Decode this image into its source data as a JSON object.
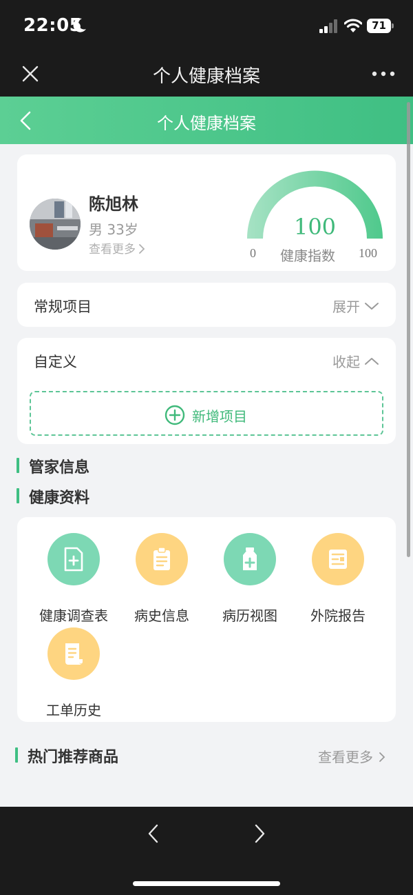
{
  "status_bar": {
    "time": "22:05",
    "battery": "71"
  },
  "app_bar": {
    "title": "个人健康档案"
  },
  "header": {
    "title": "个人健康档案"
  },
  "profile": {
    "name": "陈旭林",
    "info": "男 33岁",
    "more_link": "查看更多",
    "health_index": {
      "value": "100",
      "min": "0",
      "max": "100",
      "label": "健康指数",
      "level": 1.0
    }
  },
  "sections": {
    "regular": {
      "title": "常规项目",
      "toggle": "展开"
    },
    "custom": {
      "title": "自定义",
      "toggle": "收起",
      "add_button": "新增项目"
    }
  },
  "headings": {
    "steward": "管家信息",
    "health_materials": "健康资料",
    "products": "热门推荐商品"
  },
  "materials": [
    {
      "label": "健康调查表",
      "icon": "health-survey-icon",
      "color": "#7dd8b4"
    },
    {
      "label": "病史信息",
      "icon": "medical-history-icon",
      "color": "#fed581"
    },
    {
      "label": "病历视图",
      "icon": "medical-record-icon",
      "color": "#7dd8b4"
    },
    {
      "label": "外院报告",
      "icon": "external-report-icon",
      "color": "#fed581"
    },
    {
      "label": "工单历史",
      "icon": "work-order-history-icon",
      "color": "#fed581"
    }
  ],
  "products": {
    "more_link": "查看更多"
  },
  "colors": {
    "accent": "#3fbf83",
    "header_start": "#5ccf94",
    "header_end": "#3fbf83",
    "icon_green": "#7dd8b4",
    "icon_yellow": "#fed581"
  }
}
